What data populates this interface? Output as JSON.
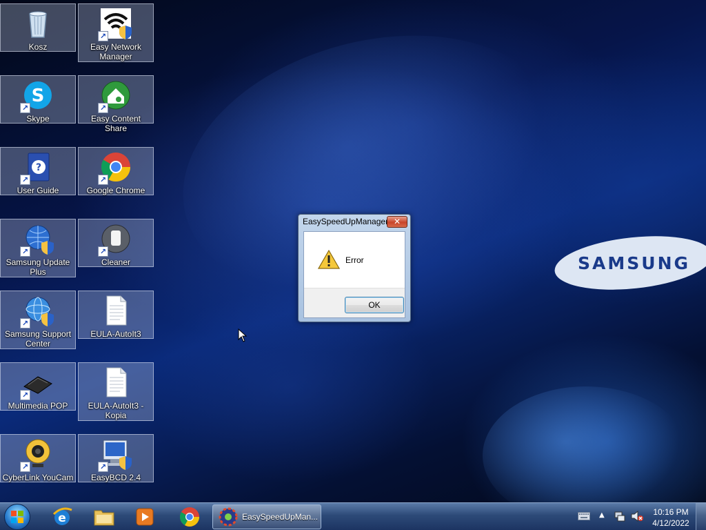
{
  "desktop": {
    "icons": [
      {
        "label": "Kosz"
      },
      {
        "label": "Easy Network Manager"
      },
      {
        "label": "Skype"
      },
      {
        "label": "Easy Content Share"
      },
      {
        "label": "User Guide"
      },
      {
        "label": "Google Chrome"
      },
      {
        "label": "Samsung Update Plus"
      },
      {
        "label": "Cleaner"
      },
      {
        "label": "Samsung Support Center"
      },
      {
        "label": "EULA-AutoIt3"
      },
      {
        "label": "Multimedia POP"
      },
      {
        "label": "EULA-AutoIt3 - Kopia"
      },
      {
        "label": "CyberLink YouCam"
      },
      {
        "label": "EasyBCD 2.4"
      }
    ],
    "wallpaper_brand": "SAMSUNG"
  },
  "dialog": {
    "title": "EasySpeedUpManager",
    "close_symbol": "✕",
    "message": "Error",
    "ok_label": "OK",
    "icon": "warning-icon"
  },
  "taskbar": {
    "pinned": [
      "internet-explorer-icon",
      "windows-explorer-icon",
      "media-player-icon",
      "google-chrome-icon"
    ],
    "active_task_label": "EasySpeedUpMan...",
    "clock_time": "10:16 PM",
    "clock_date": "4/12/2022"
  },
  "colors": {
    "taskbar": "#2d4a78",
    "dialog_frame": "#a9c2e0",
    "close_button": "#c8442a"
  }
}
